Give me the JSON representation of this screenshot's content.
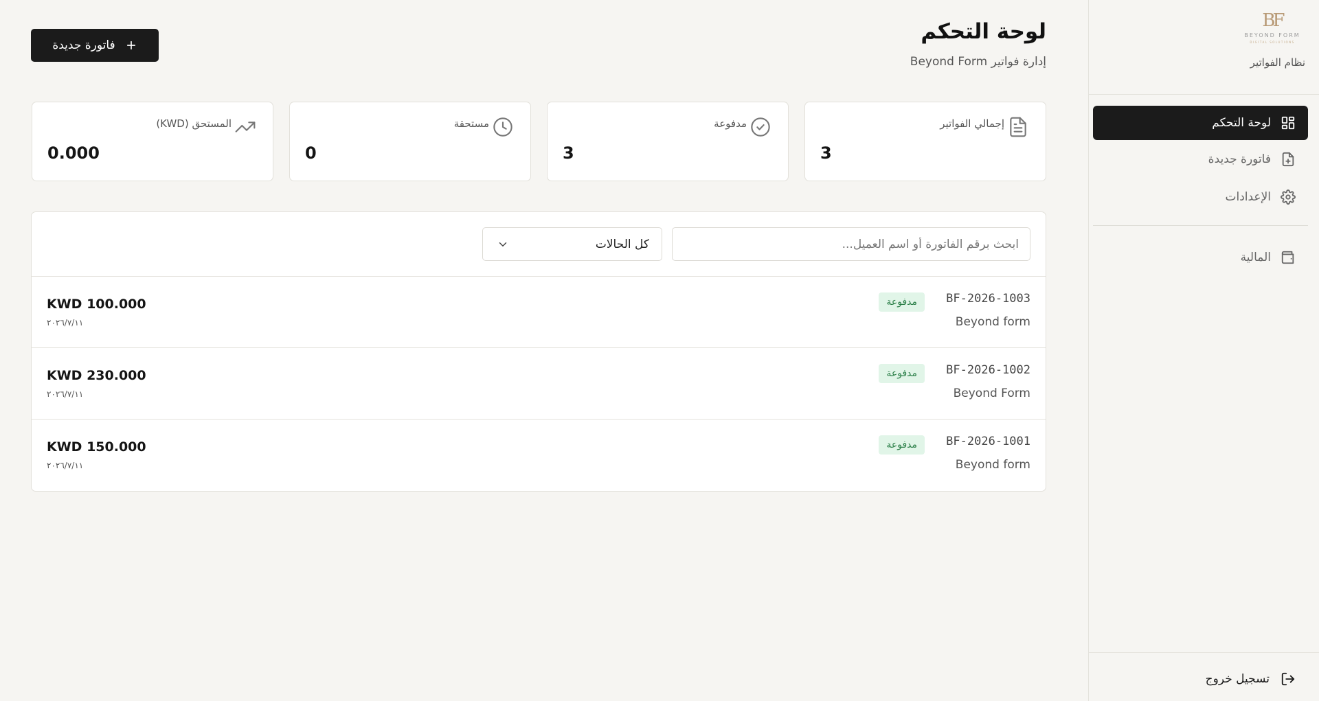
{
  "sidebar": {
    "brand": {
      "mark": "BF",
      "name": "BEYOND FORM",
      "tagline": "DIGITAL SOLUTIONS",
      "subtitle": "نظام الفواتير"
    },
    "nav": [
      {
        "label": "لوحة التحكم",
        "icon": "grid-icon",
        "active": true
      },
      {
        "label": "فاتورة جديدة",
        "icon": "file-plus-icon",
        "active": false
      },
      {
        "label": "الإعدادات",
        "icon": "gear-icon",
        "active": false
      },
      {
        "label": "المالية",
        "icon": "wallet-icon",
        "active": false
      }
    ],
    "logout_label": "تسجيل خروج"
  },
  "header": {
    "title": "لوحة التحكم",
    "subtitle": "إدارة فواتير Beyond Form",
    "new_button_label": "فاتورة جديدة"
  },
  "stats": [
    {
      "label": "إجمالي الفواتير",
      "value": "3",
      "icon": "document-icon"
    },
    {
      "label": "مدفوعة",
      "value": "3",
      "icon": "check-circle-icon"
    },
    {
      "label": "مستحقة",
      "value": "0",
      "icon": "clock-icon"
    },
    {
      "label": "المستحق (KWD)",
      "value": "0.000",
      "icon": "trending-up-icon"
    }
  ],
  "filters": {
    "search_placeholder": "ابحث برقم الفاتورة أو اسم العميل...",
    "status_selected": "كل الحالات"
  },
  "invoices": [
    {
      "number": "BF-2026-1003",
      "status": "مدفوعة",
      "client": "Beyond form",
      "amount": "KWD 100.000",
      "date": "٢٠٢٦/٧/١١"
    },
    {
      "number": "BF-2026-1002",
      "status": "مدفوعة",
      "client": "Beyond Form",
      "amount": "KWD 230.000",
      "date": "٢٠٢٦/٧/١١"
    },
    {
      "number": "BF-2026-1001",
      "status": "مدفوعة",
      "client": "Beyond form",
      "amount": "KWD 150.000",
      "date": "٢٠٢٦/٧/١١"
    }
  ],
  "colors": {
    "background": "#f6f5f2",
    "accent_dark": "#1b1b1b",
    "badge_bg": "#e1f5e8",
    "badge_text": "#2a7e47"
  }
}
